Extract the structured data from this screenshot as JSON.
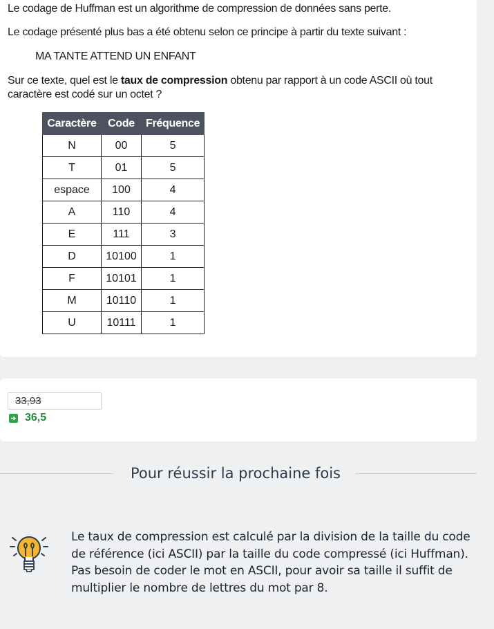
{
  "question": {
    "intro": "Le codage de Huffman est un algorithme de compression de données sans perte.",
    "context": "Le codage présenté plus bas a été obtenu selon ce principe à partir du texte suivant :",
    "quote": "MA TANTE ATTEND UN ENFANT",
    "ask_before": "Sur ce texte, quel est le ",
    "ask_bold": "taux de compression",
    "ask_after": " obtenu par rapport à un code ASCII où tout caractère est codé sur un octet ?"
  },
  "table": {
    "headers": [
      "Caractère",
      "Code",
      "Fréquence"
    ],
    "rows": [
      [
        "N",
        "00",
        "5"
      ],
      [
        "T",
        "01",
        "5"
      ],
      [
        "espace",
        "100",
        "4"
      ],
      [
        "A",
        "110",
        "4"
      ],
      [
        "E",
        "111",
        "3"
      ],
      [
        "D",
        "10100",
        "1"
      ],
      [
        "F",
        "10101",
        "1"
      ],
      [
        "M",
        "10110",
        "1"
      ],
      [
        "U",
        "10111",
        "1"
      ]
    ]
  },
  "answer": {
    "user_value": "33,93",
    "correct_value": "36,5",
    "colors": {
      "correct": "#1e8a3a",
      "arrow_bg": "#29a745"
    }
  },
  "tip": {
    "title": "Pour réussir la prochaine fois",
    "text": "Le taux de compression est calculé par la division de la taille du code de référence (ici ASCII) par la taille du code compressé (ici Huffman). Pas besoin de coder le mot en ASCII, pour avoir sa taille il suffit de multiplier le nombre de lettres du mot par 8.",
    "icon": "lightbulb-icon"
  }
}
